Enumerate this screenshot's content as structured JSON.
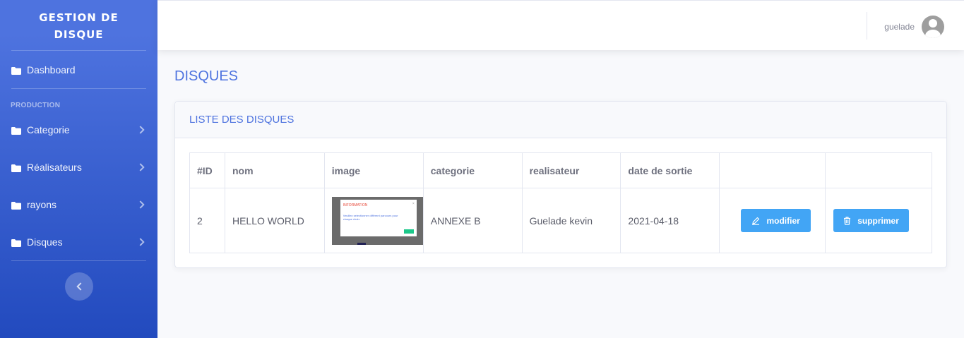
{
  "sidebar": {
    "brand_line1": "GESTION DE",
    "brand_line2": "DISQUE",
    "dashboard": "Dashboard",
    "heading": "PRODUCTION",
    "items": [
      {
        "label": "Categorie"
      },
      {
        "label": "Réalisateurs"
      },
      {
        "label": "rayons"
      },
      {
        "label": "Disques"
      }
    ]
  },
  "topbar": {
    "username": "guelade"
  },
  "page": {
    "title": "DISQUES"
  },
  "card": {
    "title": "LISTE DES DISQUES"
  },
  "table": {
    "headers": [
      "#ID",
      "nom",
      "image",
      "categorie",
      "realisateur",
      "date de sortie",
      "",
      ""
    ],
    "rows": [
      {
        "id": "2",
        "nom": "HELLO WORLD",
        "image_title": "INFORMATION",
        "image_text": "Veuillez selectionner différent parcours pour chaque choix",
        "categorie": "ANNEXE B",
        "realisateur": "Guelade kevin",
        "date": "2021-04-18",
        "edit_label": "modifier",
        "delete_label": "supprimer"
      }
    ]
  },
  "colors": {
    "primary": "#4e73df",
    "button": "#42a5f5"
  }
}
